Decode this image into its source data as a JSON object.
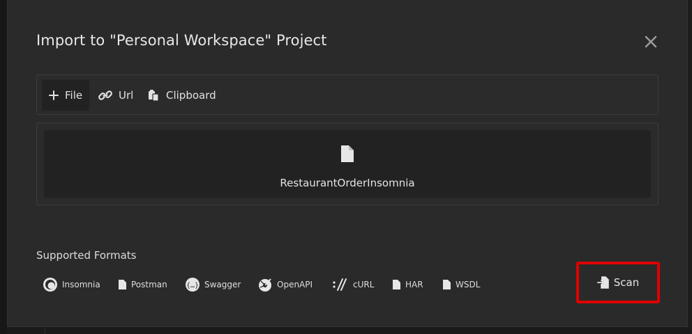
{
  "dialog": {
    "title": "Import to \"Personal Workspace\" Project",
    "close_icon": "close-icon"
  },
  "tabs": [
    {
      "label": "File",
      "icon": "plus-icon",
      "active": true
    },
    {
      "label": "Url",
      "icon": "link-icon",
      "active": false
    },
    {
      "label": "Clipboard",
      "icon": "clipboard-icon",
      "active": false
    }
  ],
  "dropzone": {
    "icon": "file-icon",
    "filename": "RestaurantOrderInsomnia"
  },
  "supported_formats": {
    "label": "Supported Formats",
    "items": [
      {
        "label": "Insomnia",
        "icon": "insomnia-icon"
      },
      {
        "label": "Postman",
        "icon": "file-icon"
      },
      {
        "label": "Swagger",
        "icon": "swagger-icon"
      },
      {
        "label": "OpenAPI",
        "icon": "openapi-icon"
      },
      {
        "label": "cURL",
        "icon": "curl-icon"
      },
      {
        "label": "HAR",
        "icon": "file-icon"
      },
      {
        "label": "WSDL",
        "icon": "file-icon"
      }
    ]
  },
  "actions": {
    "scan_label": "Scan",
    "scan_icon": "file-import-icon"
  },
  "colors": {
    "background": "#2a2a2a",
    "panel_inner": "#222222",
    "border": "#3c3c3c",
    "text": "#e4e4e4",
    "highlight": "#e00000"
  }
}
